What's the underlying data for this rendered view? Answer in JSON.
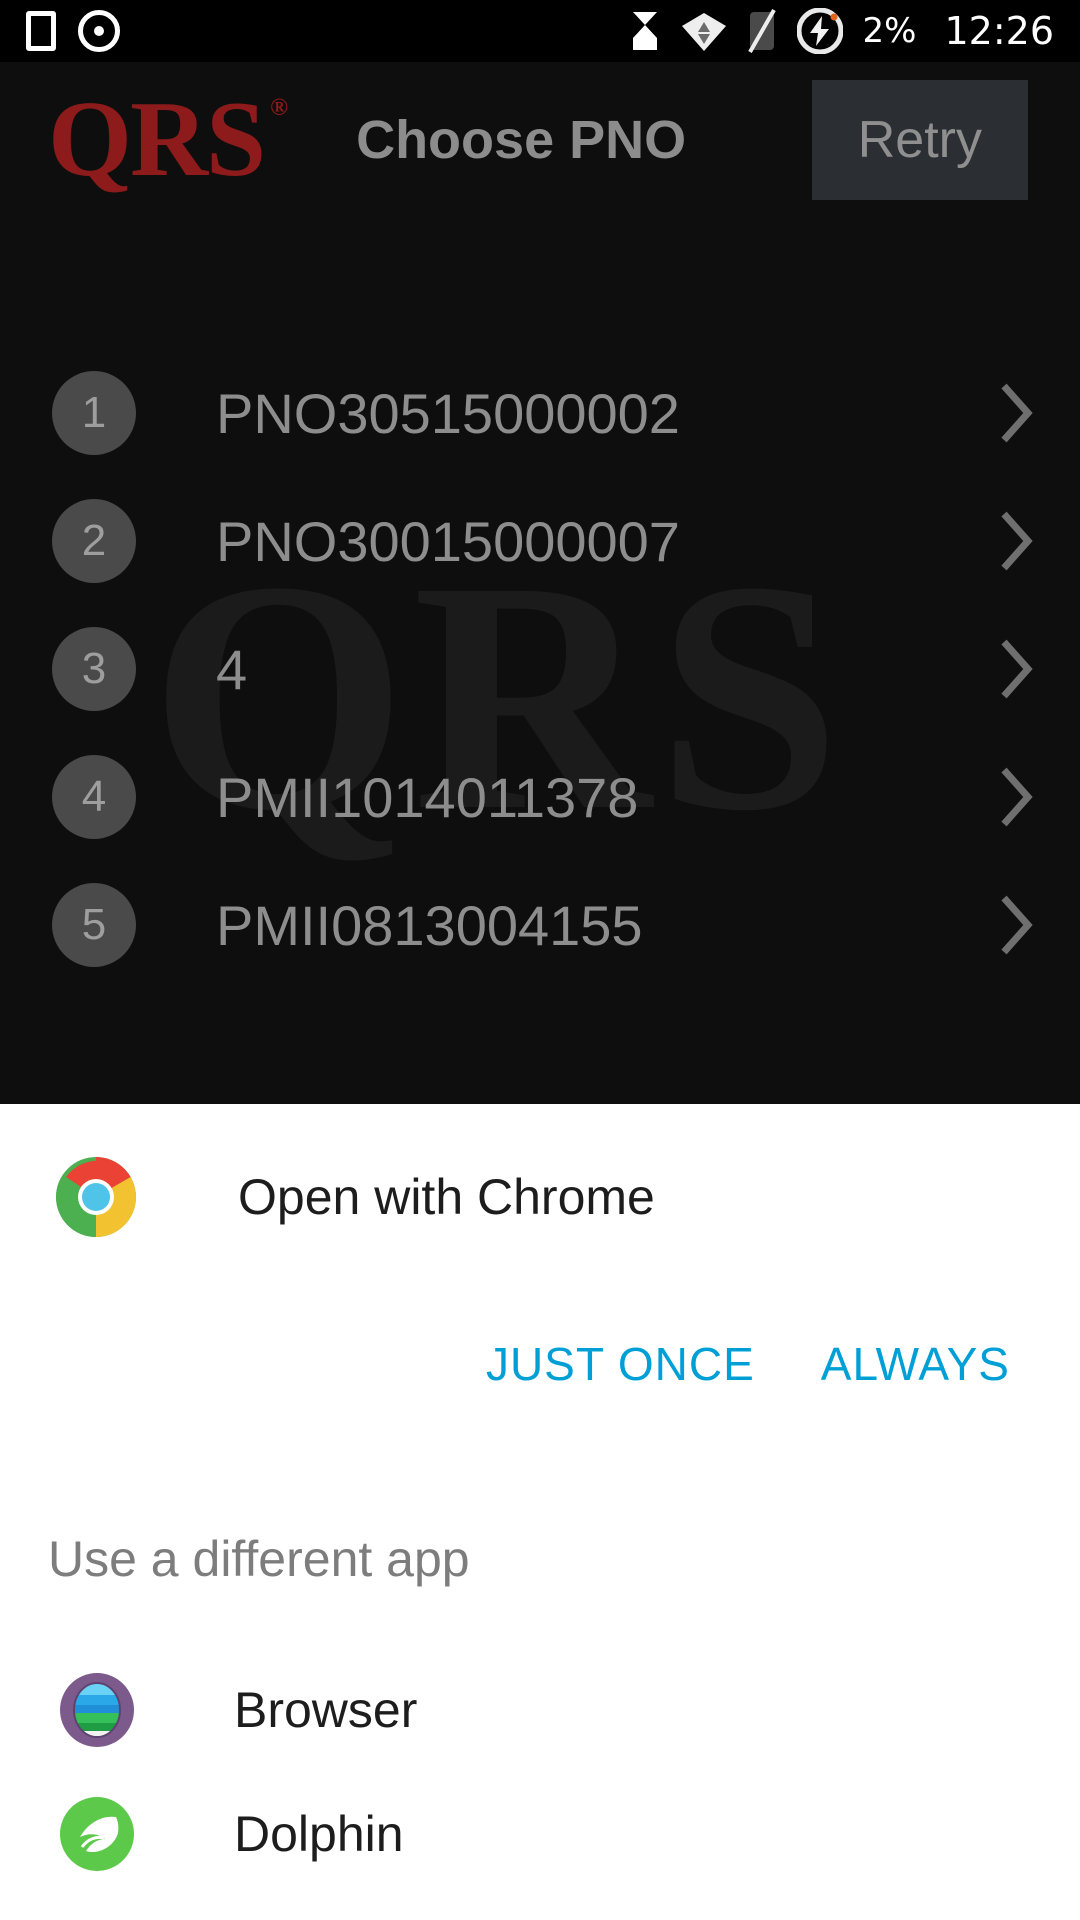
{
  "status_bar": {
    "icons_left": [
      "stop-square-icon",
      "record-dot-icon"
    ],
    "icons_right": [
      "hourglass-icon",
      "wifi-icon",
      "no-sim-icon",
      "battery-charging-icon"
    ],
    "battery_percent": "2%",
    "clock": "12:26"
  },
  "app": {
    "logo_text": "QRS",
    "logo_trademark": "®",
    "logo_color": "#8e1b1b",
    "watermark_text": "QRS",
    "title": "Choose PNO",
    "retry_label": "Retry",
    "pno_rows": [
      {
        "index": "1",
        "label": "PNO30515000002"
      },
      {
        "index": "2",
        "label": "PNO30015000007"
      },
      {
        "index": "3",
        "label": "4"
      },
      {
        "index": "4",
        "label": "PMII1014011378"
      },
      {
        "index": "5",
        "label": "PMII0813004155"
      }
    ]
  },
  "chooser": {
    "chosen": {
      "icon": "chrome-icon",
      "label": "Open with Chrome"
    },
    "just_once_label": "JUST ONCE",
    "always_label": "ALWAYS",
    "action_color": "#00a0d6",
    "different_app_title": "Use a different app",
    "other_apps": [
      {
        "icon": "browser-icon",
        "label": "Browser"
      },
      {
        "icon": "dolphin-icon",
        "label": "Dolphin"
      }
    ]
  }
}
